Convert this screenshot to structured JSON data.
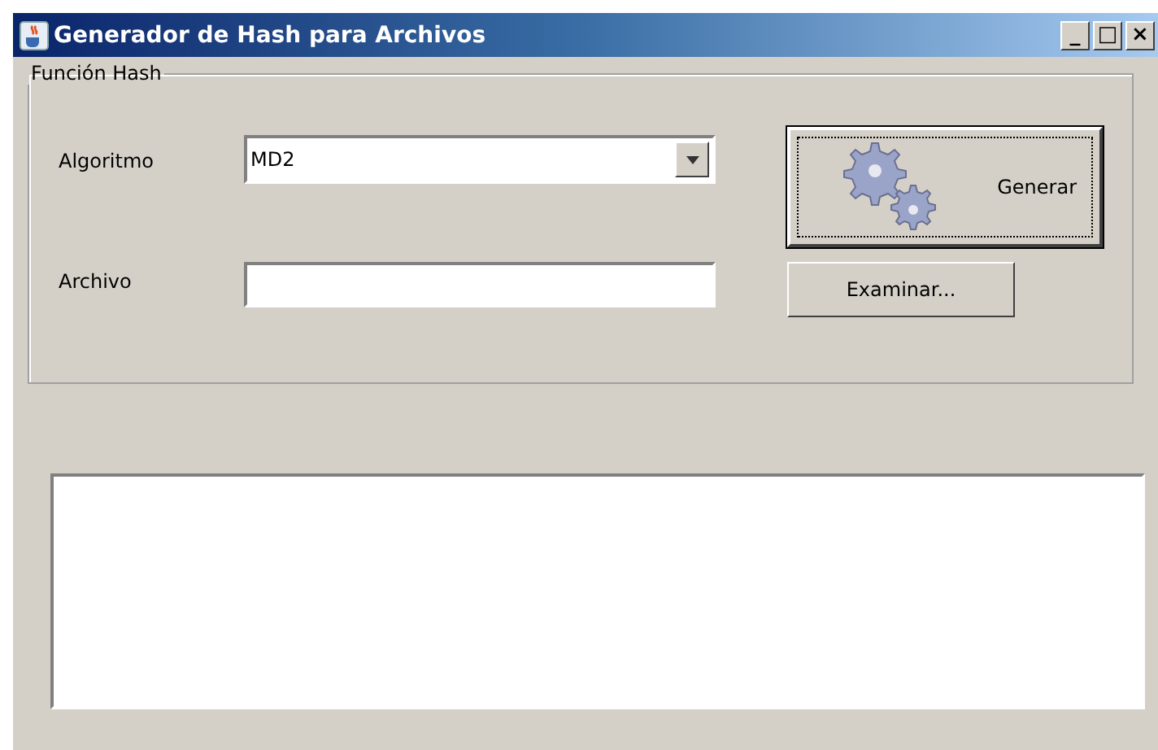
{
  "window": {
    "title": "Generador de Hash para Archivos",
    "controls": [
      "_",
      "□",
      "×"
    ]
  },
  "group": {
    "title": "Función Hash",
    "algorithm": {
      "label": "Algoritmo",
      "value": "MD2"
    },
    "file": {
      "label": "Archivo"
    },
    "generate_button": {
      "label": "Generar",
      "focused": true
    },
    "browse_button": {
      "label": "Examinar..."
    }
  }
}
